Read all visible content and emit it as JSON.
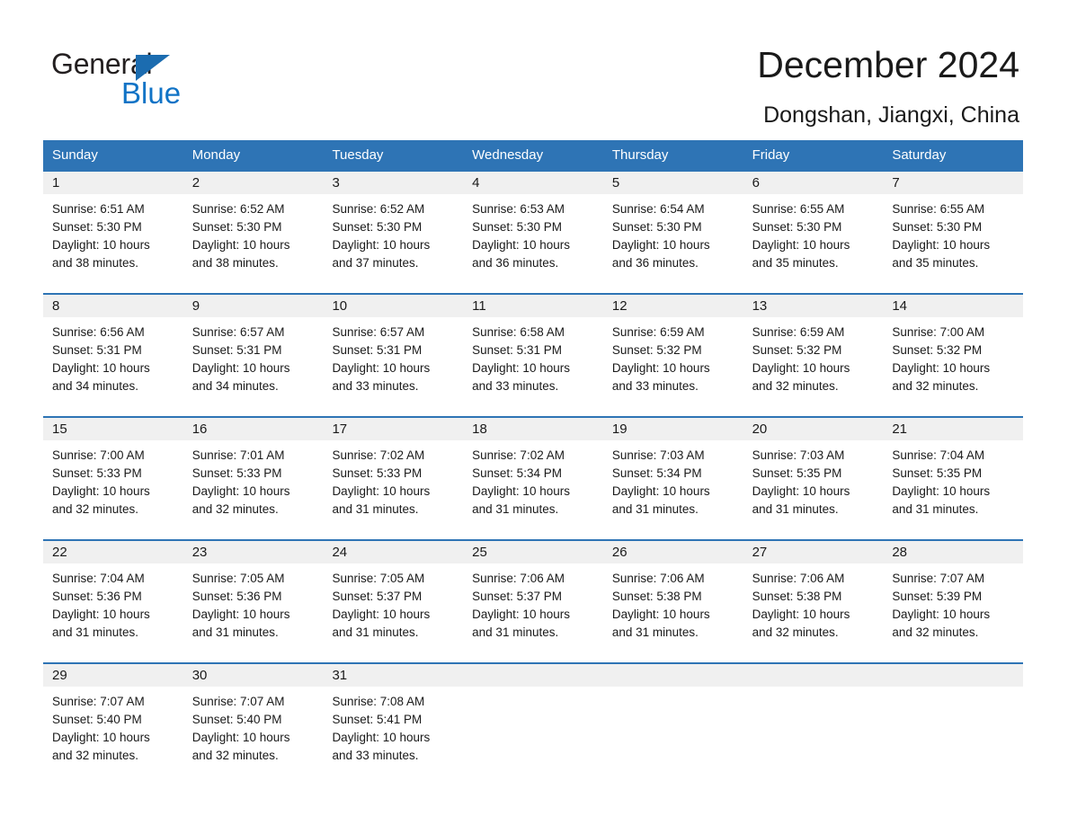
{
  "brand": {
    "name_part1": "General",
    "name_part2": "Blue",
    "triangle_color": "#1b6cb0",
    "blue_color": "#1073c6"
  },
  "header": {
    "title": "December 2024",
    "subtitle": "Dongshan, Jiangxi, China",
    "accent_color": "#2e74b5",
    "daynum_band_color": "#f0f0f0"
  },
  "weekday_headers": [
    "Sunday",
    "Monday",
    "Tuesday",
    "Wednesday",
    "Thursday",
    "Friday",
    "Saturday"
  ],
  "weeks": [
    {
      "days": [
        {
          "num": "1",
          "sunrise": "Sunrise: 6:51 AM",
          "sunset": "Sunset: 5:30 PM",
          "daylight1": "Daylight: 10 hours",
          "daylight2": "and 38 minutes."
        },
        {
          "num": "2",
          "sunrise": "Sunrise: 6:52 AM",
          "sunset": "Sunset: 5:30 PM",
          "daylight1": "Daylight: 10 hours",
          "daylight2": "and 38 minutes."
        },
        {
          "num": "3",
          "sunrise": "Sunrise: 6:52 AM",
          "sunset": "Sunset: 5:30 PM",
          "daylight1": "Daylight: 10 hours",
          "daylight2": "and 37 minutes."
        },
        {
          "num": "4",
          "sunrise": "Sunrise: 6:53 AM",
          "sunset": "Sunset: 5:30 PM",
          "daylight1": "Daylight: 10 hours",
          "daylight2": "and 36 minutes."
        },
        {
          "num": "5",
          "sunrise": "Sunrise: 6:54 AM",
          "sunset": "Sunset: 5:30 PM",
          "daylight1": "Daylight: 10 hours",
          "daylight2": "and 36 minutes."
        },
        {
          "num": "6",
          "sunrise": "Sunrise: 6:55 AM",
          "sunset": "Sunset: 5:30 PM",
          "daylight1": "Daylight: 10 hours",
          "daylight2": "and 35 minutes."
        },
        {
          "num": "7",
          "sunrise": "Sunrise: 6:55 AM",
          "sunset": "Sunset: 5:30 PM",
          "daylight1": "Daylight: 10 hours",
          "daylight2": "and 35 minutes."
        }
      ]
    },
    {
      "days": [
        {
          "num": "8",
          "sunrise": "Sunrise: 6:56 AM",
          "sunset": "Sunset: 5:31 PM",
          "daylight1": "Daylight: 10 hours",
          "daylight2": "and 34 minutes."
        },
        {
          "num": "9",
          "sunrise": "Sunrise: 6:57 AM",
          "sunset": "Sunset: 5:31 PM",
          "daylight1": "Daylight: 10 hours",
          "daylight2": "and 34 minutes."
        },
        {
          "num": "10",
          "sunrise": "Sunrise: 6:57 AM",
          "sunset": "Sunset: 5:31 PM",
          "daylight1": "Daylight: 10 hours",
          "daylight2": "and 33 minutes."
        },
        {
          "num": "11",
          "sunrise": "Sunrise: 6:58 AM",
          "sunset": "Sunset: 5:31 PM",
          "daylight1": "Daylight: 10 hours",
          "daylight2": "and 33 minutes."
        },
        {
          "num": "12",
          "sunrise": "Sunrise: 6:59 AM",
          "sunset": "Sunset: 5:32 PM",
          "daylight1": "Daylight: 10 hours",
          "daylight2": "and 33 minutes."
        },
        {
          "num": "13",
          "sunrise": "Sunrise: 6:59 AM",
          "sunset": "Sunset: 5:32 PM",
          "daylight1": "Daylight: 10 hours",
          "daylight2": "and 32 minutes."
        },
        {
          "num": "14",
          "sunrise": "Sunrise: 7:00 AM",
          "sunset": "Sunset: 5:32 PM",
          "daylight1": "Daylight: 10 hours",
          "daylight2": "and 32 minutes."
        }
      ]
    },
    {
      "days": [
        {
          "num": "15",
          "sunrise": "Sunrise: 7:00 AM",
          "sunset": "Sunset: 5:33 PM",
          "daylight1": "Daylight: 10 hours",
          "daylight2": "and 32 minutes."
        },
        {
          "num": "16",
          "sunrise": "Sunrise: 7:01 AM",
          "sunset": "Sunset: 5:33 PM",
          "daylight1": "Daylight: 10 hours",
          "daylight2": "and 32 minutes."
        },
        {
          "num": "17",
          "sunrise": "Sunrise: 7:02 AM",
          "sunset": "Sunset: 5:33 PM",
          "daylight1": "Daylight: 10 hours",
          "daylight2": "and 31 minutes."
        },
        {
          "num": "18",
          "sunrise": "Sunrise: 7:02 AM",
          "sunset": "Sunset: 5:34 PM",
          "daylight1": "Daylight: 10 hours",
          "daylight2": "and 31 minutes."
        },
        {
          "num": "19",
          "sunrise": "Sunrise: 7:03 AM",
          "sunset": "Sunset: 5:34 PM",
          "daylight1": "Daylight: 10 hours",
          "daylight2": "and 31 minutes."
        },
        {
          "num": "20",
          "sunrise": "Sunrise: 7:03 AM",
          "sunset": "Sunset: 5:35 PM",
          "daylight1": "Daylight: 10 hours",
          "daylight2": "and 31 minutes."
        },
        {
          "num": "21",
          "sunrise": "Sunrise: 7:04 AM",
          "sunset": "Sunset: 5:35 PM",
          "daylight1": "Daylight: 10 hours",
          "daylight2": "and 31 minutes."
        }
      ]
    },
    {
      "days": [
        {
          "num": "22",
          "sunrise": "Sunrise: 7:04 AM",
          "sunset": "Sunset: 5:36 PM",
          "daylight1": "Daylight: 10 hours",
          "daylight2": "and 31 minutes."
        },
        {
          "num": "23",
          "sunrise": "Sunrise: 7:05 AM",
          "sunset": "Sunset: 5:36 PM",
          "daylight1": "Daylight: 10 hours",
          "daylight2": "and 31 minutes."
        },
        {
          "num": "24",
          "sunrise": "Sunrise: 7:05 AM",
          "sunset": "Sunset: 5:37 PM",
          "daylight1": "Daylight: 10 hours",
          "daylight2": "and 31 minutes."
        },
        {
          "num": "25",
          "sunrise": "Sunrise: 7:06 AM",
          "sunset": "Sunset: 5:37 PM",
          "daylight1": "Daylight: 10 hours",
          "daylight2": "and 31 minutes."
        },
        {
          "num": "26",
          "sunrise": "Sunrise: 7:06 AM",
          "sunset": "Sunset: 5:38 PM",
          "daylight1": "Daylight: 10 hours",
          "daylight2": "and 31 minutes."
        },
        {
          "num": "27",
          "sunrise": "Sunrise: 7:06 AM",
          "sunset": "Sunset: 5:38 PM",
          "daylight1": "Daylight: 10 hours",
          "daylight2": "and 32 minutes."
        },
        {
          "num": "28",
          "sunrise": "Sunrise: 7:07 AM",
          "sunset": "Sunset: 5:39 PM",
          "daylight1": "Daylight: 10 hours",
          "daylight2": "and 32 minutes."
        }
      ]
    },
    {
      "days": [
        {
          "num": "29",
          "sunrise": "Sunrise: 7:07 AM",
          "sunset": "Sunset: 5:40 PM",
          "daylight1": "Daylight: 10 hours",
          "daylight2": "and 32 minutes."
        },
        {
          "num": "30",
          "sunrise": "Sunrise: 7:07 AM",
          "sunset": "Sunset: 5:40 PM",
          "daylight1": "Daylight: 10 hours",
          "daylight2": "and 32 minutes."
        },
        {
          "num": "31",
          "sunrise": "Sunrise: 7:08 AM",
          "sunset": "Sunset: 5:41 PM",
          "daylight1": "Daylight: 10 hours",
          "daylight2": "and 33 minutes."
        },
        {
          "num": "",
          "sunrise": "",
          "sunset": "",
          "daylight1": "",
          "daylight2": ""
        },
        {
          "num": "",
          "sunrise": "",
          "sunset": "",
          "daylight1": "",
          "daylight2": ""
        },
        {
          "num": "",
          "sunrise": "",
          "sunset": "",
          "daylight1": "",
          "daylight2": ""
        },
        {
          "num": "",
          "sunrise": "",
          "sunset": "",
          "daylight1": "",
          "daylight2": ""
        }
      ]
    }
  ]
}
